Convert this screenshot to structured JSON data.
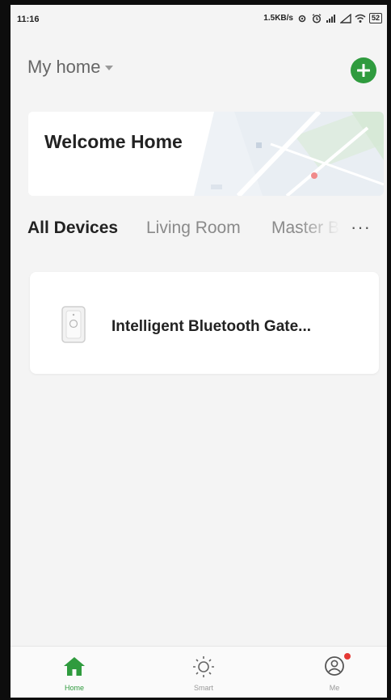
{
  "status_bar": {
    "time": "11:16",
    "speed": "1.5KB/s",
    "battery": "52"
  },
  "header": {
    "home_name": "My home"
  },
  "welcome_card": {
    "text": "Welcome Home"
  },
  "room_tabs": {
    "items": [
      "All Devices",
      "Living Room",
      "Master B"
    ],
    "active": "All Devices",
    "more": "···"
  },
  "devices": [
    {
      "name": "Intelligent Bluetooth Gate..."
    }
  ],
  "bottom_nav": {
    "items": [
      {
        "label": "Home",
        "icon": "home-icon"
      },
      {
        "label": "Smart",
        "icon": "sun-icon"
      },
      {
        "label": "Me",
        "icon": "user-icon"
      }
    ],
    "active": "Home"
  },
  "colors": {
    "accent": "#2f9b3e",
    "notification": "#e53935",
    "background": "#f4f4f4"
  }
}
